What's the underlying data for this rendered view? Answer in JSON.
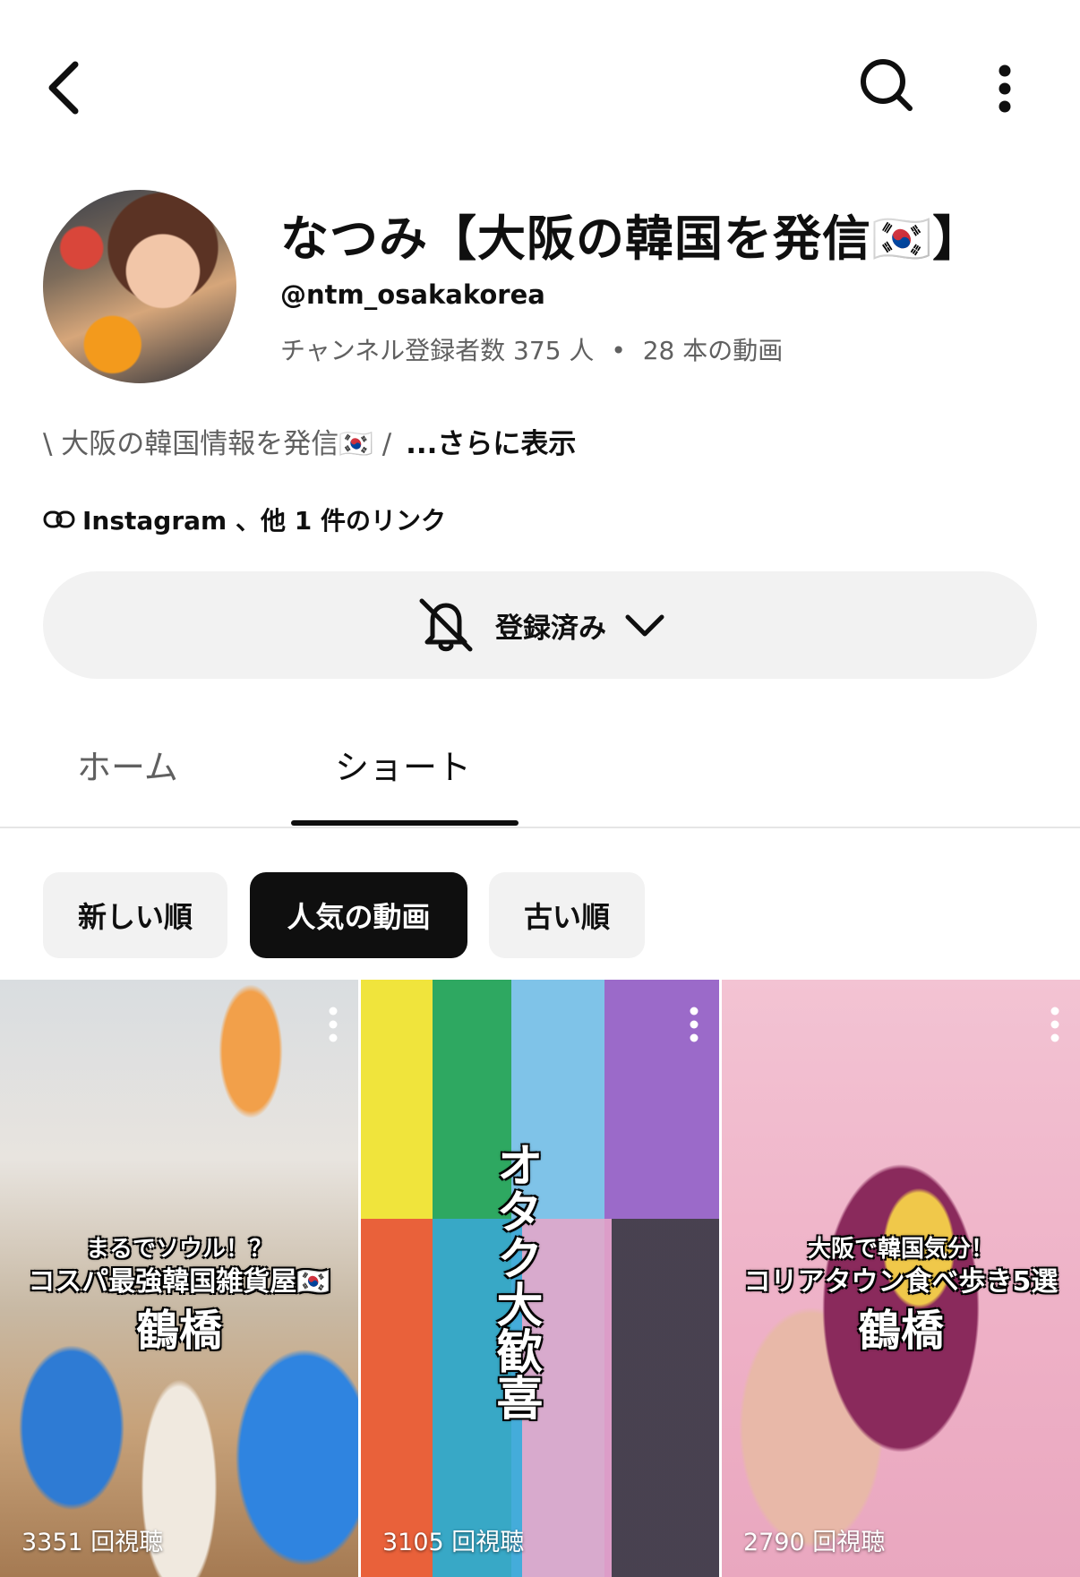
{
  "channel": {
    "name": "なつみ【大阪の韓国を発信🇰🇷】",
    "handle": "@ntm_osakakorea",
    "subscribers": "チャンネル登録者数 375 人",
    "separator": "•",
    "videos": "28 本の動画",
    "description": "\\ 大阪の韓国情報を発信🇰🇷 /",
    "more": "...さらに表示",
    "links": "Instagram 、他 1 件のリンク"
  },
  "subscribe": {
    "label": "登録済み"
  },
  "tabs": [
    {
      "label": "ホーム"
    },
    {
      "label": "ショート"
    }
  ],
  "chips": [
    {
      "label": "新しい順"
    },
    {
      "label": "人気の動画"
    },
    {
      "label": "古い順"
    }
  ],
  "shorts": [
    {
      "views": "3351 回視聴",
      "line1": "まるでソウル！？",
      "line2": "コスパ最強韓国雑貨屋🇰🇷",
      "line3": "鶴橋"
    },
    {
      "views": "3105 回視聴",
      "vertical": "オタク大歓喜"
    },
    {
      "views": "2790 回視聴",
      "line1": "大阪で韓国気分！",
      "line2": "コリアタウン食べ歩き5選",
      "line3": "鶴橋"
    }
  ],
  "icons": [
    "back-arrow-icon",
    "search-icon",
    "more-vert-icon",
    "link-icon",
    "bell-off-icon",
    "chevron-down-icon"
  ]
}
